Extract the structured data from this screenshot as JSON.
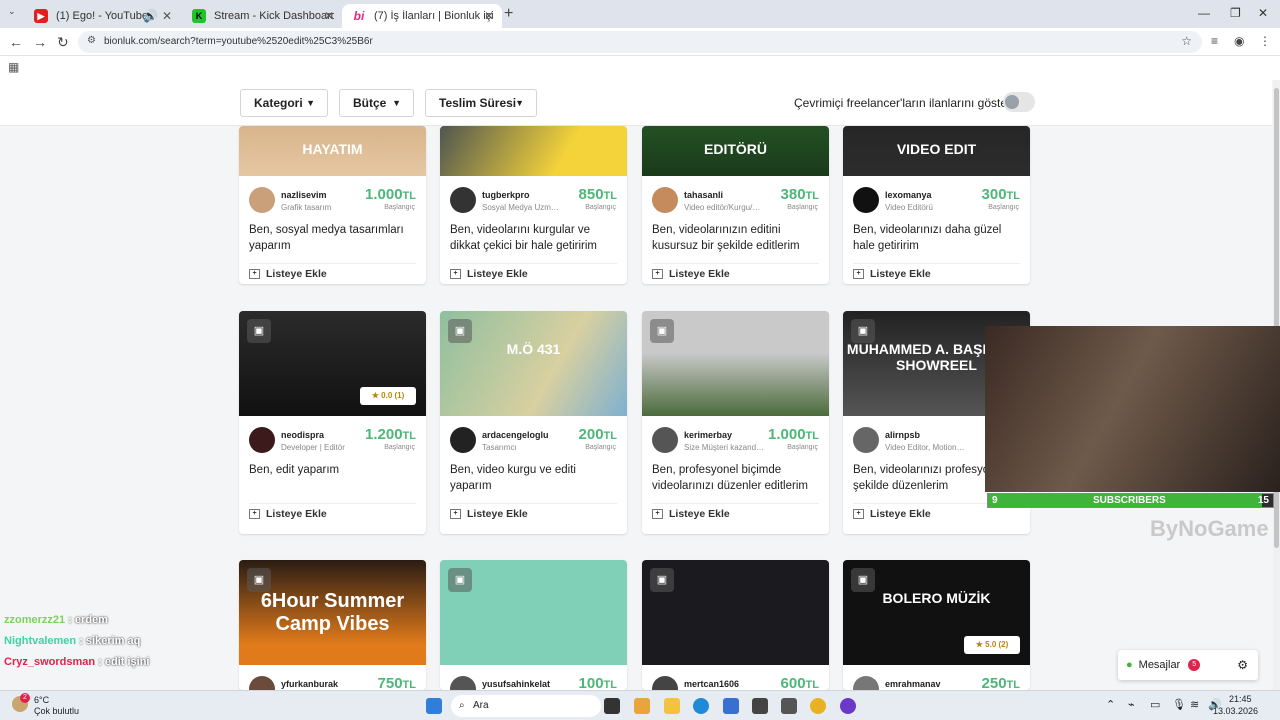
{
  "browser": {
    "tabs": [
      {
        "label": "(1) Ego! - YouTube",
        "favicon": "youtube-icon",
        "color": "#e02020"
      },
      {
        "label": "Stream - Kick Dashboard",
        "favicon": "kick-icon",
        "color": "#22c32a"
      },
      {
        "label": "(7) İş İlanları | Bionluk içinde yo…",
        "favicon": "bionluk-icon",
        "color": "#e02c7a"
      }
    ],
    "url": "bionluk.com/search?term=youtube%2520edit%25C3%25B6r"
  },
  "filters": {
    "kategori": "Kategori",
    "butce": "Bütçe",
    "teslim": "Teslim Süresi",
    "online_label": "Çevrimiçi freelancer'ların ilanlarını göster"
  },
  "start_label": "Başlangıç",
  "list_label": "Listeye Ekle",
  "cards": [
    {
      "user": "nazlisevim",
      "role": "Grafik tasarım",
      "price": "1.000",
      "cur": "TL",
      "title": "Ben, sosyal medya tasarımları yaparım",
      "thumb_text": "HAYATIM"
    },
    {
      "user": "tugberkpro",
      "role": "Sosyal Medya Uzm…",
      "price": "850",
      "cur": "TL",
      "title": "Ben, videolarını kurgular ve dikkat çekici bir hale getiririm",
      "thumb_text": ""
    },
    {
      "user": "tahasanli",
      "role": "Video editör/Kurgu/…",
      "price": "380",
      "cur": "TL",
      "title": "Ben, videolarınızın editini kusursuz bir şekilde editlerim",
      "thumb_text": "EDITÖRÜ"
    },
    {
      "user": "lexomanya",
      "role": "Video Editörü",
      "price": "300",
      "cur": "TL",
      "title": "Ben, videolarınızı daha güzel hale getiririm",
      "thumb_text": "VIDEO EDIT"
    },
    {
      "user": "neodispra",
      "role": "Developer | Editör",
      "price": "1.200",
      "cur": "TL",
      "title": "Ben, edit yaparım",
      "thumb_text": "",
      "rating": "0.0 (1)"
    },
    {
      "user": "ardacengeloglu",
      "role": "Tasarımcı",
      "price": "200",
      "cur": "TL",
      "title": "Ben, video kurgu ve editi yaparım",
      "thumb_text": "M.Ö 431"
    },
    {
      "user": "kerimerbay",
      "role": "Size Müşteri kazand…",
      "price": "1.000",
      "cur": "TL",
      "title": "Ben, profesyonel biçimde videolarınızı düzenler editlerim",
      "thumb_text": ""
    },
    {
      "user": "alirnpsb",
      "role": "Video Editor, Motion…",
      "price": "1.",
      "cur": "",
      "title": "Ben, videolarınızı profesyonel şekilde düzenlerim",
      "thumb_text": "MUHAMMED A. BAŞPINAR SHOWREEL"
    },
    {
      "user": "yfurkanburak",
      "role": "",
      "price": "750",
      "cur": "TL",
      "title": "",
      "thumb_text": "6Hour Summer Camp Vibes"
    },
    {
      "user": "yusufsahinkelat",
      "role": "",
      "price": "100",
      "cur": "TL",
      "title": "",
      "thumb_text": ""
    },
    {
      "user": "mertcan1606",
      "role": "",
      "price": "600",
      "cur": "TL",
      "title": "",
      "thumb_text": ""
    },
    {
      "user": "emrahmanav",
      "role": "",
      "price": "250",
      "cur": "TL",
      "title": "",
      "thumb_text": "BOLERO MÜZİK",
      "rating": "5.0 (2)"
    }
  ],
  "overlay": {
    "sub_left": "9",
    "sub_label": "SUBSCRIBERS",
    "sub_right": "15",
    "brand": "ByNoGame",
    "sub_progress": 0.96
  },
  "chat": [
    {
      "user": "zzomerzz21",
      "msg": "erdem",
      "color": "#7bd35a"
    },
    {
      "user": "Nightvalemen",
      "msg": "sikerim aq",
      "color": "#3fd3a0"
    },
    {
      "user": "Cryz_swordsman",
      "msg": "edit işini",
      "color": "#e0234a"
    }
  ],
  "messages": {
    "label": "Mesajlar",
    "count": "5"
  },
  "taskbar": {
    "weather_temp": "6°C",
    "weather_desc": "Çok bulutlu",
    "weather_badge": "2",
    "search": "Ara",
    "time": "21:45",
    "date": "13.03.2026"
  }
}
